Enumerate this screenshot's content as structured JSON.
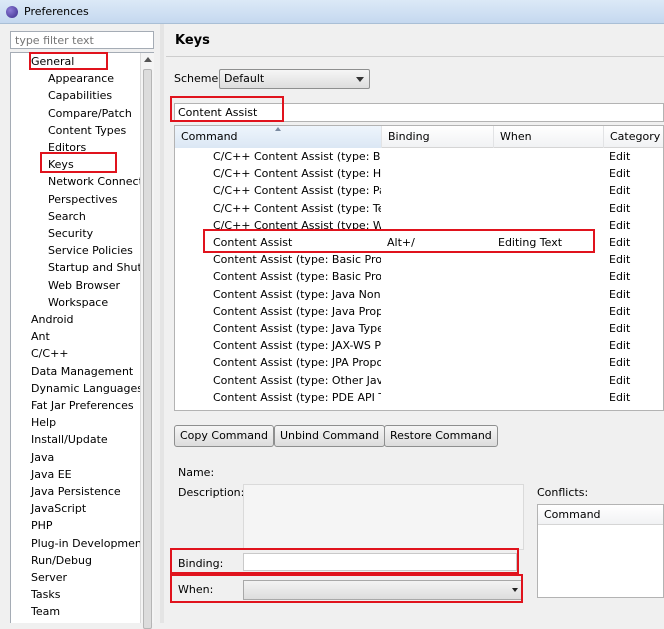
{
  "window": {
    "title": "Preferences"
  },
  "filter": {
    "placeholder": "type filter text"
  },
  "tree": {
    "items": [
      {
        "label": "General",
        "indent": 0
      },
      {
        "label": "Appearance",
        "indent": 1
      },
      {
        "label": "Capabilities",
        "indent": 1
      },
      {
        "label": "Compare/Patch",
        "indent": 1
      },
      {
        "label": "Content Types",
        "indent": 1
      },
      {
        "label": "Editors",
        "indent": 1
      },
      {
        "label": "Keys",
        "indent": 1
      },
      {
        "label": "Network Connectio",
        "indent": 1
      },
      {
        "label": "Perspectives",
        "indent": 1
      },
      {
        "label": "Search",
        "indent": 1
      },
      {
        "label": "Security",
        "indent": 1
      },
      {
        "label": "Service Policies",
        "indent": 1
      },
      {
        "label": "Startup and Shutd",
        "indent": 1
      },
      {
        "label": "Web Browser",
        "indent": 1
      },
      {
        "label": "Workspace",
        "indent": 1
      },
      {
        "label": "Android",
        "indent": 0
      },
      {
        "label": "Ant",
        "indent": 0
      },
      {
        "label": "C/C++",
        "indent": 0
      },
      {
        "label": "Data Management",
        "indent": 0
      },
      {
        "label": "Dynamic Languages",
        "indent": 0
      },
      {
        "label": "Fat Jar Preferences",
        "indent": 0
      },
      {
        "label": "Help",
        "indent": 0
      },
      {
        "label": "Install/Update",
        "indent": 0
      },
      {
        "label": "Java",
        "indent": 0
      },
      {
        "label": "Java EE",
        "indent": 0
      },
      {
        "label": "Java Persistence",
        "indent": 0
      },
      {
        "label": "JavaScript",
        "indent": 0
      },
      {
        "label": "PHP",
        "indent": 0
      },
      {
        "label": "Plug-in Development",
        "indent": 0
      },
      {
        "label": "Run/Debug",
        "indent": 0
      },
      {
        "label": "Server",
        "indent": 0
      },
      {
        "label": "Tasks",
        "indent": 0
      },
      {
        "label": "Team",
        "indent": 0
      }
    ]
  },
  "keys": {
    "title": "Keys",
    "scheme_label": "Scheme:",
    "scheme_value": "Default",
    "search_value": "Content Assist",
    "columns": [
      "Command",
      "Binding",
      "When",
      "Category"
    ],
    "rows": [
      {
        "command": "C/C++ Content Assist (type: Basic",
        "binding": "",
        "when": "",
        "category": "Edit"
      },
      {
        "command": "C/C++ Content Assist (type: Help",
        "binding": "",
        "when": "",
        "category": "Edit"
      },
      {
        "command": "C/C++ Content Assist (type: Parsin",
        "binding": "",
        "when": "",
        "category": "Edit"
      },
      {
        "command": "C/C++ Content Assist (type: Temp",
        "binding": "",
        "when": "",
        "category": "Edit"
      },
      {
        "command": "C/C++ Content Assist (type: Word",
        "binding": "",
        "when": "",
        "category": "Edit"
      },
      {
        "command": "Content Assist",
        "binding": "Alt+/",
        "when": "Editing Text",
        "category": "Edit"
      },
      {
        "command": "Content Assist (type: Basic Propos",
        "binding": "",
        "when": "",
        "category": "Edit"
      },
      {
        "command": "Content Assist (type: Basic Propos",
        "binding": "",
        "when": "",
        "category": "Edit"
      },
      {
        "command": "Content Assist (type: Java Non-Typ",
        "binding": "",
        "when": "",
        "category": "Edit"
      },
      {
        "command": "Content Assist (type: Java Proposa",
        "binding": "",
        "when": "",
        "category": "Edit"
      },
      {
        "command": "Content Assist (type: Java Type Pro",
        "binding": "",
        "when": "",
        "category": "Edit"
      },
      {
        "command": "Content Assist (type: JAX-WS Prop",
        "binding": "",
        "when": "",
        "category": "Edit"
      },
      {
        "command": "Content Assist (type: JPA Proposal",
        "binding": "",
        "when": "",
        "category": "Edit"
      },
      {
        "command": "Content Assist (type: Other JavaSc",
        "binding": "",
        "when": "",
        "category": "Edit"
      },
      {
        "command": "Content Assist (type: PDE API Tool",
        "binding": "",
        "when": "",
        "category": "Edit"
      }
    ],
    "buttons": {
      "copy": "Copy Command",
      "unbind": "Unbind Command",
      "restore": "Restore Command"
    },
    "name_label": "Name:",
    "description_label": "Description:",
    "binding_label": "Binding:",
    "when_label": "When:",
    "conflicts_label": "Conflicts:",
    "conflicts_column": "Command"
  },
  "colors": {
    "highlight": "#e0131d",
    "accent": "#3a2a8a"
  }
}
